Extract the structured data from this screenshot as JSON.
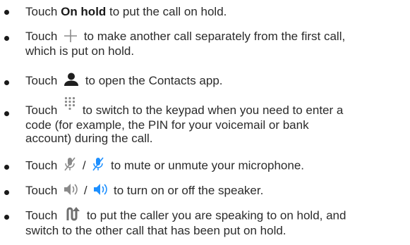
{
  "items": [
    {
      "prefix": "Touch ",
      "bold": "On hold",
      "suffix": " to put the call on hold."
    },
    {
      "prefix": "Touch ",
      "icon": "plus-icon",
      "suffix": " to make another call separately from the first call,",
      "line2": "which is put on hold."
    },
    {
      "prefix": "Touch ",
      "icon": "person-icon",
      "suffix": " to open the Contacts app."
    },
    {
      "prefix": "Touch ",
      "icon": "keypad-icon",
      "suffix": " to switch to the keypad when you need to enter a",
      "line2": "code (for example, the PIN for your voicemail or bank",
      "line3": "account) during the call."
    },
    {
      "prefix": "Touch ",
      "icon": "mute-off-icon",
      "separator": " / ",
      "icon2": "mute-on-icon",
      "suffix": " to mute or unmute your microphone."
    },
    {
      "prefix": "Touch ",
      "icon": "speaker-off-icon",
      "separator": " / ",
      "icon2": "speaker-on-icon",
      "suffix": " to turn on or off the speaker."
    },
    {
      "prefix": "Touch ",
      "icon": "swap-calls-icon",
      "suffix": " to put the caller you are speaking to on hold, and",
      "line2": "switch to the other call that has been put on hold."
    }
  ],
  "colors": {
    "text": "#2b2b2b",
    "icon_gray": "#8a8a8a",
    "icon_dark": "#222222",
    "icon_blue": "#1e90ff"
  }
}
